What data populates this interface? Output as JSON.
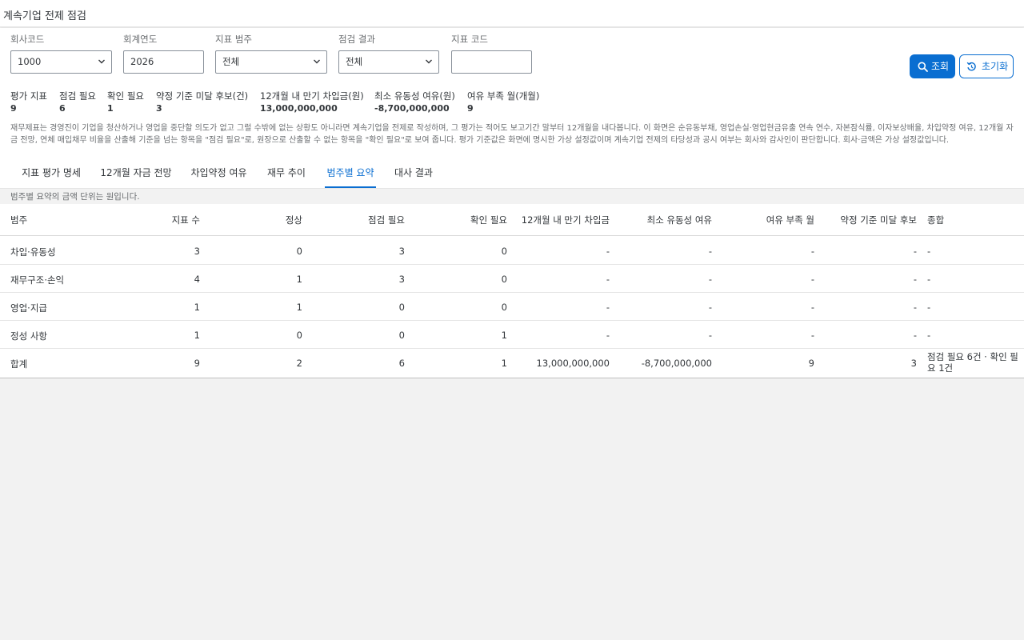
{
  "app": {
    "title": "계속기업 전제 점검"
  },
  "filters": {
    "company_code": {
      "label": "회사코드",
      "value": "1000"
    },
    "fiscal_year": {
      "label": "회계연도",
      "value": "2026"
    },
    "indicator_category": {
      "label": "지표 범주",
      "value": "전체"
    },
    "check_result": {
      "label": "점검 결과",
      "value": "전체"
    },
    "indicator_code": {
      "label": "지표 코드",
      "value": ""
    }
  },
  "actions": {
    "search_label": "조회",
    "reset_label": "초기화"
  },
  "kpis": [
    {
      "label": "평가 지표",
      "value": "9"
    },
    {
      "label": "점검 필요",
      "value": "6"
    },
    {
      "label": "확인 필요",
      "value": "1"
    },
    {
      "label": "약정 기준 미달 후보(건)",
      "value": "3"
    },
    {
      "label": "12개월 내 만기 차입금(원)",
      "value": "13,000,000,000"
    },
    {
      "label": "최소 유동성 여유(원)",
      "value": "-8,700,000,000"
    },
    {
      "label": "여유 부족 월(개월)",
      "value": "9"
    }
  ],
  "description": "재무제표는 경영진이 기업을 청산하거나 영업을 중단할 의도가 없고 그럴 수밖에 없는 상황도 아니라면 계속기업을 전제로 작성하며, 그 평가는 적어도 보고기간 말부터 12개월을 내다봅니다. 이 화면은 순유동부채, 영업손실·영업현금유출 연속 연수, 자본잠식률, 이자보상배율, 차입약정 여유, 12개월 자금 전망, 연체 매입채무 비율을 산출해 기준을 넘는 항목을 \"점검 필요\"로, 원장으로 산출할 수 없는 항목을 \"확인 필요\"로 보여 줍니다. 평가 기준값은 화면에 명시한 가상 설정값이며 계속기업 전제의 타당성과 공시 여부는 회사와 감사인이 판단합니다. 회사·금액은 가상 설정값입니다.",
  "tabs": [
    {
      "label": "지표 평가 명세"
    },
    {
      "label": "12개월 자금 전망"
    },
    {
      "label": "차입약정 여유"
    },
    {
      "label": "재무 추이"
    },
    {
      "label": "범주별 요약"
    },
    {
      "label": "대사 결과"
    }
  ],
  "active_tab": "범주별 요약",
  "note": "범주별 요약의 금액 단위는 원입니다.",
  "table": {
    "columns": [
      "범주",
      "지표 수",
      "정상",
      "점검 필요",
      "확인 필요",
      "12개월 내 만기 차입금",
      "최소 유동성 여유",
      "여유 부족 월",
      "약정 기준 미달 후보",
      "종합"
    ],
    "rows": [
      [
        "차입·유동성",
        "3",
        "0",
        "3",
        "0",
        "-",
        "-",
        "-",
        "-",
        "-"
      ],
      [
        "재무구조·손익",
        "4",
        "1",
        "3",
        "0",
        "-",
        "-",
        "-",
        "-",
        "-"
      ],
      [
        "영업·지급",
        "1",
        "1",
        "0",
        "0",
        "-",
        "-",
        "-",
        "-",
        "-"
      ],
      [
        "정성 사항",
        "1",
        "0",
        "0",
        "1",
        "-",
        "-",
        "-",
        "-",
        "-"
      ],
      [
        "합계",
        "9",
        "2",
        "6",
        "1",
        "13,000,000,000",
        "-8,700,000,000",
        "9",
        "3",
        "점검 필요 6건 · 확인 필요 1건"
      ]
    ]
  },
  "colors": {
    "accent": "#0a6ed1",
    "background": "#f2f2f2"
  }
}
